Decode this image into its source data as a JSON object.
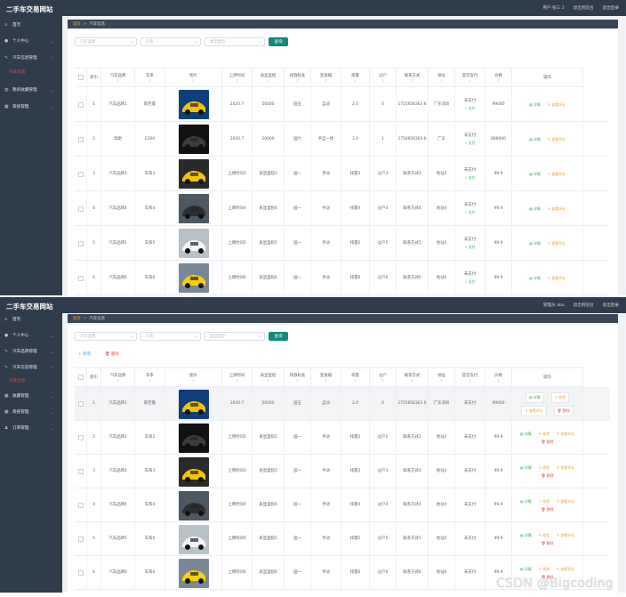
{
  "panel1": {
    "app_title": "二手车交易网站",
    "top_links": [
      "用户:张三 2",
      "退出到前台",
      "退出登录"
    ],
    "menu": [
      {
        "icon": "home-icon",
        "label": "首页"
      },
      {
        "icon": "user-icon",
        "label": "个人中心"
      },
      {
        "icon": "edit-icon",
        "label": "汽车信息管理"
      },
      {
        "icon": "chart-icon",
        "label": "我的收藏管理"
      },
      {
        "icon": "grid-icon",
        "label": "系统管理"
      }
    ],
    "active_submenu": "汽车信息",
    "breadcrumb": {
      "home": "首页",
      "sep": ">",
      "current": "汽车信息"
    },
    "search": {
      "brand_placeholder": "汽车品牌",
      "series_placeholder": "车系",
      "type_placeholder": "类型类型",
      "button": "查询"
    }
  },
  "panel2": {
    "app_title": "二手车交易网站",
    "top_links": [
      "管理员 abo",
      "退出到前台",
      "退出登录"
    ],
    "menu": [
      {
        "icon": "home-icon",
        "label": "首页"
      },
      {
        "icon": "user-icon",
        "label": "个人中心"
      },
      {
        "icon": "edit-icon",
        "label": "汽车品牌管理"
      },
      {
        "icon": "edit-icon",
        "label": "汽车信息管理"
      },
      {
        "icon": "grid-icon",
        "label": "收藏管理"
      },
      {
        "icon": "grid-icon",
        "label": "系统管理"
      },
      {
        "icon": "person-icon",
        "label": "订单管理"
      }
    ],
    "active_submenu": "汽车信息",
    "breadcrumb": {
      "home": "首页",
      "sep": ">",
      "current": "汽车信息"
    },
    "search": {
      "brand_placeholder": "汽车品牌",
      "series_placeholder": "车系",
      "type_placeholder": "类型类型",
      "button": "查询"
    },
    "add_button": "+ 新增",
    "delete_button": "删除"
  },
  "table_headers": [
    "索引",
    "汽车品牌",
    "车系",
    "图片",
    "上牌时间",
    "表显里程",
    "排放标准",
    "变速箱",
    "排量",
    "过户",
    "联系方式",
    "地址",
    "是否支付",
    "价格",
    "操作"
  ],
  "panel1_rows": [
    {
      "idx": "1",
      "brand": "汽车品牌1",
      "series": "斯巴鲁",
      "img": "yellow",
      "time": "2020.7",
      "mileage": "56000",
      "emission": "国五",
      "gearbox": "自动",
      "disp": "2.0",
      "transfer": "0",
      "contact": "1755656363 6",
      "addr": "广东深圳",
      "paid": "未支付",
      "pay_link": "支付",
      "price": "99000"
    },
    {
      "idx": "2",
      "brand": "奔驰",
      "series": "E300",
      "img": "black",
      "time": "2020.7",
      "mileage": "20000",
      "emission": "国六",
      "gearbox": "手自一体",
      "disp": "3.0",
      "transfer": "1",
      "contact": "1756656363 6",
      "addr": "广东",
      "paid": "未支付",
      "pay_link": "支付",
      "price": "888000"
    },
    {
      "idx": "3",
      "brand": "汽车品牌3",
      "series": "车系3",
      "img": "yellow2",
      "time": "上牌时间3",
      "mileage": "表显里程3",
      "emission": "国一",
      "gearbox": "手动",
      "disp": "排量3",
      "transfer": "过户3",
      "contact": "联系方式3",
      "addr": "地址3",
      "paid": "未支付",
      "pay_link": "支付",
      "price": "99.9"
    },
    {
      "idx": "4",
      "brand": "汽车品牌4",
      "series": "车系4",
      "img": "crowd",
      "time": "上牌时间4",
      "mileage": "表显里程4",
      "emission": "国一",
      "gearbox": "手动",
      "disp": "排量4",
      "transfer": "过户4",
      "contact": "联系方式4",
      "addr": "地址4",
      "paid": "未支付",
      "pay_link": "支付",
      "price": "99.9"
    },
    {
      "idx": "5",
      "brand": "汽车品牌5",
      "series": "车系5",
      "img": "white",
      "time": "上牌时间5",
      "mileage": "表显里程5",
      "emission": "国一",
      "gearbox": "手动",
      "disp": "排量5",
      "transfer": "过户5",
      "contact": "联系方式5",
      "addr": "地址5",
      "paid": "未支付",
      "pay_link": "支付",
      "price": "99.9"
    },
    {
      "idx": "6",
      "brand": "汽车品牌6",
      "series": "车系6",
      "img": "yellow3",
      "time": "上牌时间6",
      "mileage": "表显里程6",
      "emission": "国一",
      "gearbox": "手动",
      "disp": "排量6",
      "transfer": "过户6",
      "contact": "联系方式6",
      "addr": "地址6",
      "paid": "未支付",
      "pay_link": "支付",
      "price": "99.9"
    }
  ],
  "panel2_rows": [
    {
      "idx": "1",
      "brand": "汽车品牌1",
      "series": "斯巴鲁",
      "img": "yellow",
      "time": "2020.7",
      "mileage": "56000",
      "emission": "国五",
      "gearbox": "自动",
      "disp": "2.0",
      "transfer": "0",
      "contact": "1755656363 6",
      "addr": "广东深圳",
      "paid": "未支付",
      "price": "99000"
    },
    {
      "idx": "2",
      "brand": "汽车品牌2",
      "series": "车系2",
      "img": "black",
      "time": "上牌时间2",
      "mileage": "表显里程2",
      "emission": "国一",
      "gearbox": "手动",
      "disp": "排量2",
      "transfer": "过户2",
      "contact": "联系方式2",
      "addr": "地址2",
      "paid": "未支付",
      "price": "99.9"
    },
    {
      "idx": "3",
      "brand": "汽车品牌3",
      "series": "车系3",
      "img": "yellow2",
      "time": "上牌时间3",
      "mileage": "表显里程3",
      "emission": "国一",
      "gearbox": "手动",
      "disp": "排量3",
      "transfer": "过户3",
      "contact": "联系方式3",
      "addr": "地址3",
      "paid": "未支付",
      "price": "99.9"
    },
    {
      "idx": "4",
      "brand": "汽车品牌4",
      "series": "车系4",
      "img": "crowd",
      "time": "上牌时间4",
      "mileage": "表显里程4",
      "emission": "国一",
      "gearbox": "手动",
      "disp": "排量4",
      "transfer": "过户4",
      "contact": "联系方式4",
      "addr": "地址4",
      "paid": "未支付",
      "price": "99.9"
    },
    {
      "idx": "5",
      "brand": "汽车品牌5",
      "series": "车系5",
      "img": "white",
      "time": "上牌时间5",
      "mileage": "表显里程5",
      "emission": "国一",
      "gearbox": "手动",
      "disp": "排量5",
      "transfer": "过户5",
      "contact": "联系方式5",
      "addr": "地址5",
      "paid": "未支付",
      "price": "99.9"
    },
    {
      "idx": "6",
      "brand": "汽车品牌6",
      "series": "车系6",
      "img": "yellow3",
      "time": "上牌时间6",
      "mileage": "表显里程6",
      "emission": "国一",
      "gearbox": "手动",
      "disp": "排量6",
      "transfer": "过户6",
      "contact": "联系方式6",
      "addr": "地址6",
      "paid": "未支付",
      "price": "99.9"
    }
  ],
  "actions_user": {
    "detail": "详情",
    "comment": "查看评论"
  },
  "actions_admin": {
    "detail": "详情",
    "edit": "修改",
    "comment": "查看评论",
    "delete": "删除"
  },
  "watermark": "CSDN @Bigcoding",
  "colors": {
    "sidebar": "#2f3c4b",
    "accent": "#12897a",
    "active_menu": "#e0524f",
    "pay_green": "#3aa757"
  }
}
